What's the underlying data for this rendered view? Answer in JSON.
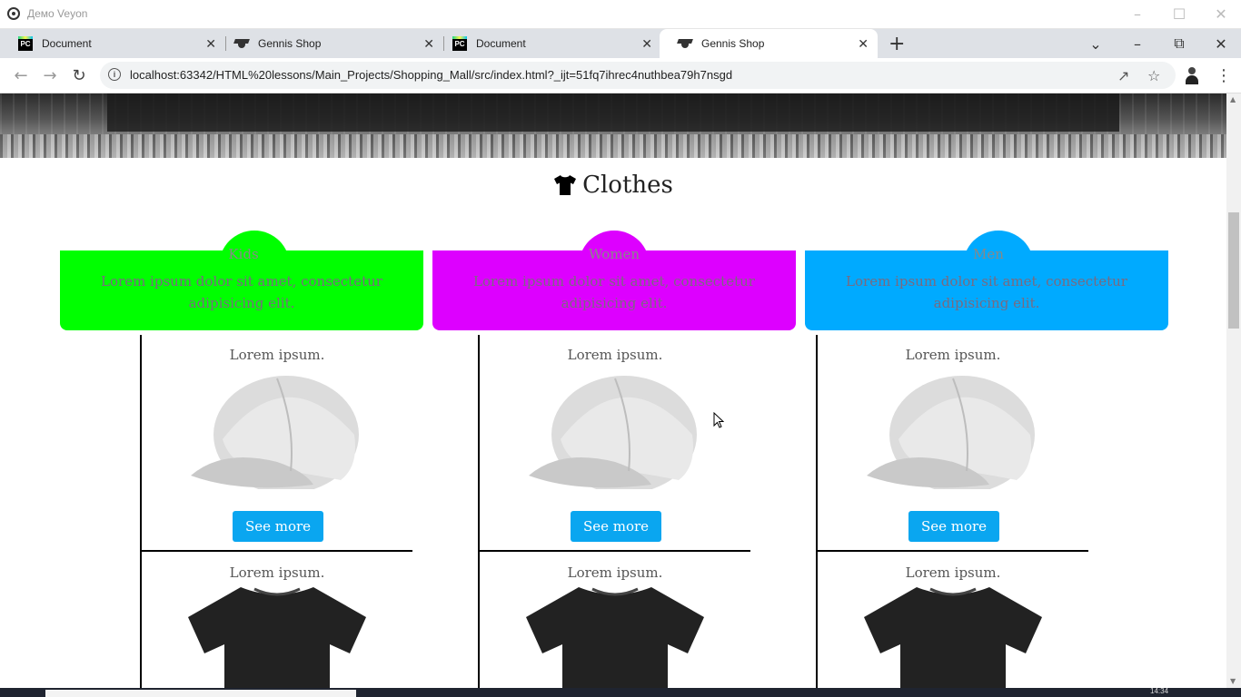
{
  "window": {
    "title": "Демо Veyon"
  },
  "tabs": [
    {
      "label": "Document",
      "favicon": "pycharm-icon"
    },
    {
      "label": "Gennis Shop",
      "favicon": "graduation-cap-icon"
    },
    {
      "label": "Document",
      "favicon": "pycharm-icon"
    },
    {
      "label": "Gennis Shop",
      "favicon": "graduation-cap-icon",
      "active": true
    }
  ],
  "address_bar": {
    "url": "localhost:63342/HTML%20lessons/Main_Projects/Shopping_Mall/src/index.html?_ijt=51fq7ihrec4nuthbea79h7nsgd"
  },
  "page": {
    "section_title": "Clothes",
    "categories": [
      {
        "name": "Kids",
        "description": "Lorem ipsum dolor sit amet, consectetur adipisicing elit.",
        "color": "#00ff00"
      },
      {
        "name": "Women",
        "description": "Lorem ipsum dolor sit amet, consectetur adipisicing elit.",
        "color": "#dd00ff"
      },
      {
        "name": "Men",
        "description": "Lorem ipsum dolor sit amet, consectetur adipisicing elit.",
        "color": "#00aaff"
      }
    ],
    "products": {
      "item_title": "Lorem ipsum.",
      "button_label": "See more",
      "button_color": "#0aa6f0"
    }
  },
  "taskbar": {
    "clock": "14:34"
  }
}
